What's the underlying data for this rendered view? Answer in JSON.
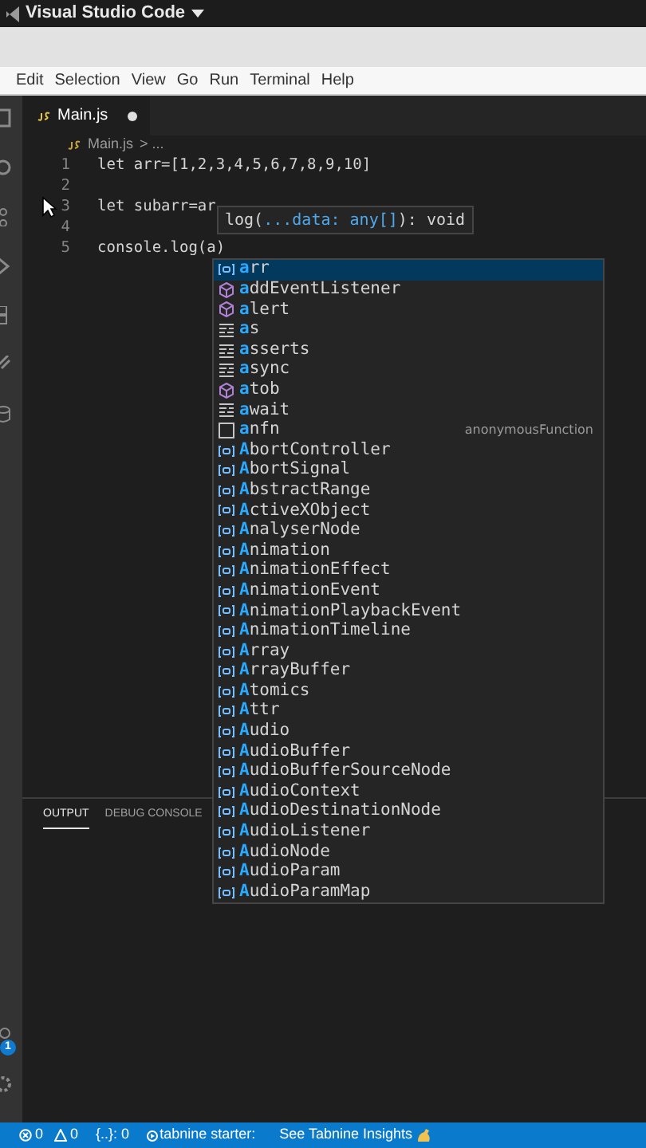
{
  "title_bar": {
    "title": "Visual Studio Code"
  },
  "menu": [
    "Edit",
    "Selection",
    "View",
    "Go",
    "Run",
    "Terminal",
    "Help"
  ],
  "activity_bar": {
    "badge": "1"
  },
  "tabs": [
    {
      "label": "Main.js",
      "selected": true,
      "modified": true
    }
  ],
  "breadcrumb": {
    "file": "Main.js",
    "rest": "> ..."
  },
  "code_lines": [
    {
      "number": "1",
      "text": "let arr=[1,2,3,4,5,6,7,8,9,10]"
    },
    {
      "number": "2"
    },
    {
      "number": "3",
      "text": "let subarr=ar"
    },
    {
      "number": "4"
    },
    {
      "number": "5",
      "text": "console.log(a)"
    }
  ],
  "parameter_hint": {
    "before": "log(",
    "param": "...data: any[]",
    "after": "): void"
  },
  "suggestions": [
    {
      "kind": "variable",
      "label": "arr",
      "selected": true
    },
    {
      "kind": "method",
      "label": "addEventListener",
      "selected": false
    },
    {
      "kind": "method",
      "label": "alert",
      "selected": false
    },
    {
      "kind": "keyword",
      "label": "as",
      "selected": false
    },
    {
      "kind": "keyword",
      "label": "asserts",
      "selected": false
    },
    {
      "kind": "keyword",
      "label": "async",
      "selected": false
    },
    {
      "kind": "method",
      "label": "atob",
      "selected": false
    },
    {
      "kind": "keyword",
      "label": "await",
      "selected": false
    },
    {
      "kind": "snippet",
      "label": "anfn",
      "detail": "anonymousFunction",
      "selected": false
    },
    {
      "kind": "variable",
      "label": "AbortController",
      "selected": false
    },
    {
      "kind": "variable",
      "label": "AbortSignal",
      "selected": false
    },
    {
      "kind": "variable",
      "label": "AbstractRange",
      "selected": false
    },
    {
      "kind": "variable",
      "label": "ActiveXObject",
      "selected": false
    },
    {
      "kind": "variable",
      "label": "AnalyserNode",
      "selected": false
    },
    {
      "kind": "variable",
      "label": "Animation",
      "selected": false
    },
    {
      "kind": "variable",
      "label": "AnimationEffect",
      "selected": false
    },
    {
      "kind": "variable",
      "label": "AnimationEvent",
      "selected": false
    },
    {
      "kind": "variable",
      "label": "AnimationPlaybackEvent",
      "selected": false
    },
    {
      "kind": "variable",
      "label": "AnimationTimeline",
      "selected": false
    },
    {
      "kind": "variable",
      "label": "Array",
      "selected": false
    },
    {
      "kind": "variable",
      "label": "ArrayBuffer",
      "selected": false
    },
    {
      "kind": "variable",
      "label": "Atomics",
      "selected": false
    },
    {
      "kind": "variable",
      "label": "Attr",
      "selected": false
    },
    {
      "kind": "variable",
      "label": "Audio",
      "selected": false
    },
    {
      "kind": "variable",
      "label": "AudioBuffer",
      "selected": false
    },
    {
      "kind": "variable",
      "label": "AudioBufferSourceNode",
      "selected": false
    },
    {
      "kind": "variable",
      "label": "AudioContext",
      "selected": false
    },
    {
      "kind": "variable",
      "label": "AudioDestinationNode",
      "selected": false
    },
    {
      "kind": "variable",
      "label": "AudioListener",
      "selected": false
    },
    {
      "kind": "variable",
      "label": "AudioNode",
      "selected": false
    },
    {
      "kind": "variable",
      "label": "AudioParam",
      "selected": false
    },
    {
      "kind": "variable",
      "label": "AudioParamMap",
      "selected": false
    }
  ],
  "panel_tabs": [
    {
      "label": "OUTPUT",
      "selected": true
    },
    {
      "label": "DEBUG CONSOLE",
      "selected": false
    }
  ],
  "status_bar": {
    "errors": "0",
    "warnings": "0",
    "braces": "{..}: 0",
    "tabnine": "tabnine starter:",
    "insights": "See Tabnine Insights"
  }
}
